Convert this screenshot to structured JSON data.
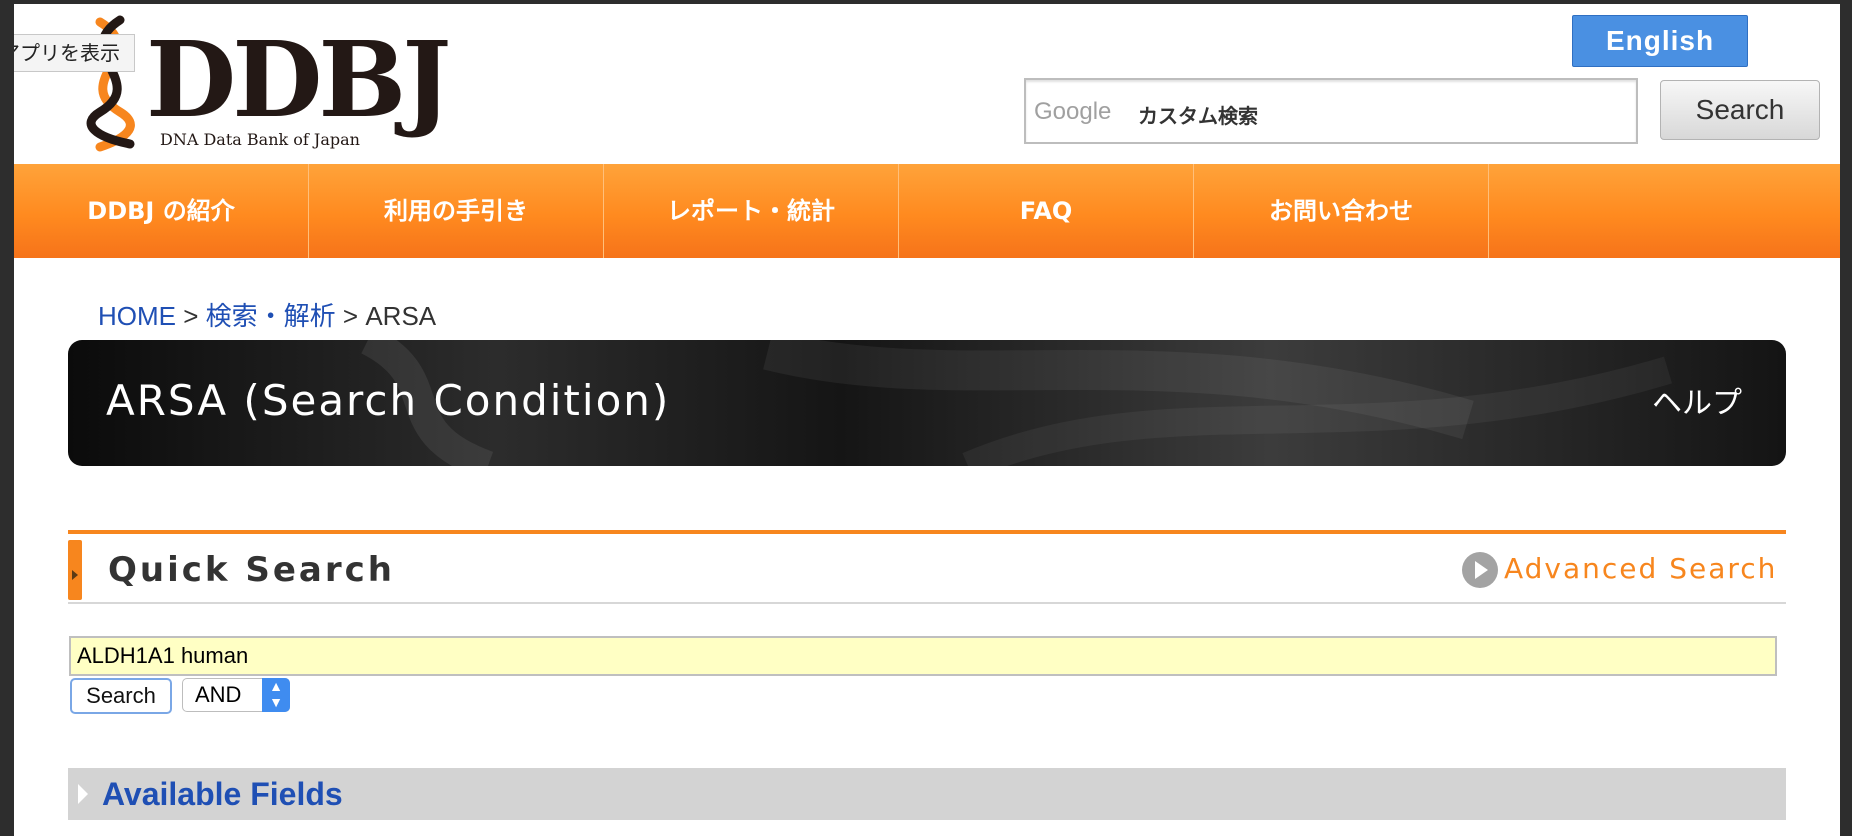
{
  "tooltip": {
    "text": "アプリを表示"
  },
  "logo": {
    "title": "DDBJ",
    "subtitle": "DNA Data Bank of Japan"
  },
  "header": {
    "language_button": "English",
    "search_brand": "Google",
    "search_placeholder": "カスタム検索",
    "search_button": "Search"
  },
  "nav": {
    "items": [
      {
        "label": "DDBJ の紹介"
      },
      {
        "label": "利用の手引き"
      },
      {
        "label": "レポート・統計"
      },
      {
        "label": "FAQ"
      },
      {
        "label": "お問い合わせ"
      },
      {
        "label": ""
      }
    ]
  },
  "breadcrumb": {
    "items": [
      "HOME",
      "検索・解析",
      "ARSA"
    ],
    "separator": ">"
  },
  "banner": {
    "title": "ARSA (Search Condition)",
    "help": "ヘルプ"
  },
  "quick_search": {
    "title": "Quick Search",
    "advanced_link": "Advanced Search",
    "query_value": "ALDH1A1 human",
    "search_button": "Search",
    "operator_selected": "AND"
  },
  "available_fields": {
    "title": "Available Fields"
  },
  "colors": {
    "accent_orange": "#f7861e",
    "link_blue": "#1f4fb4",
    "english_button": "#4a90e2",
    "query_bg": "#ffffc4"
  }
}
